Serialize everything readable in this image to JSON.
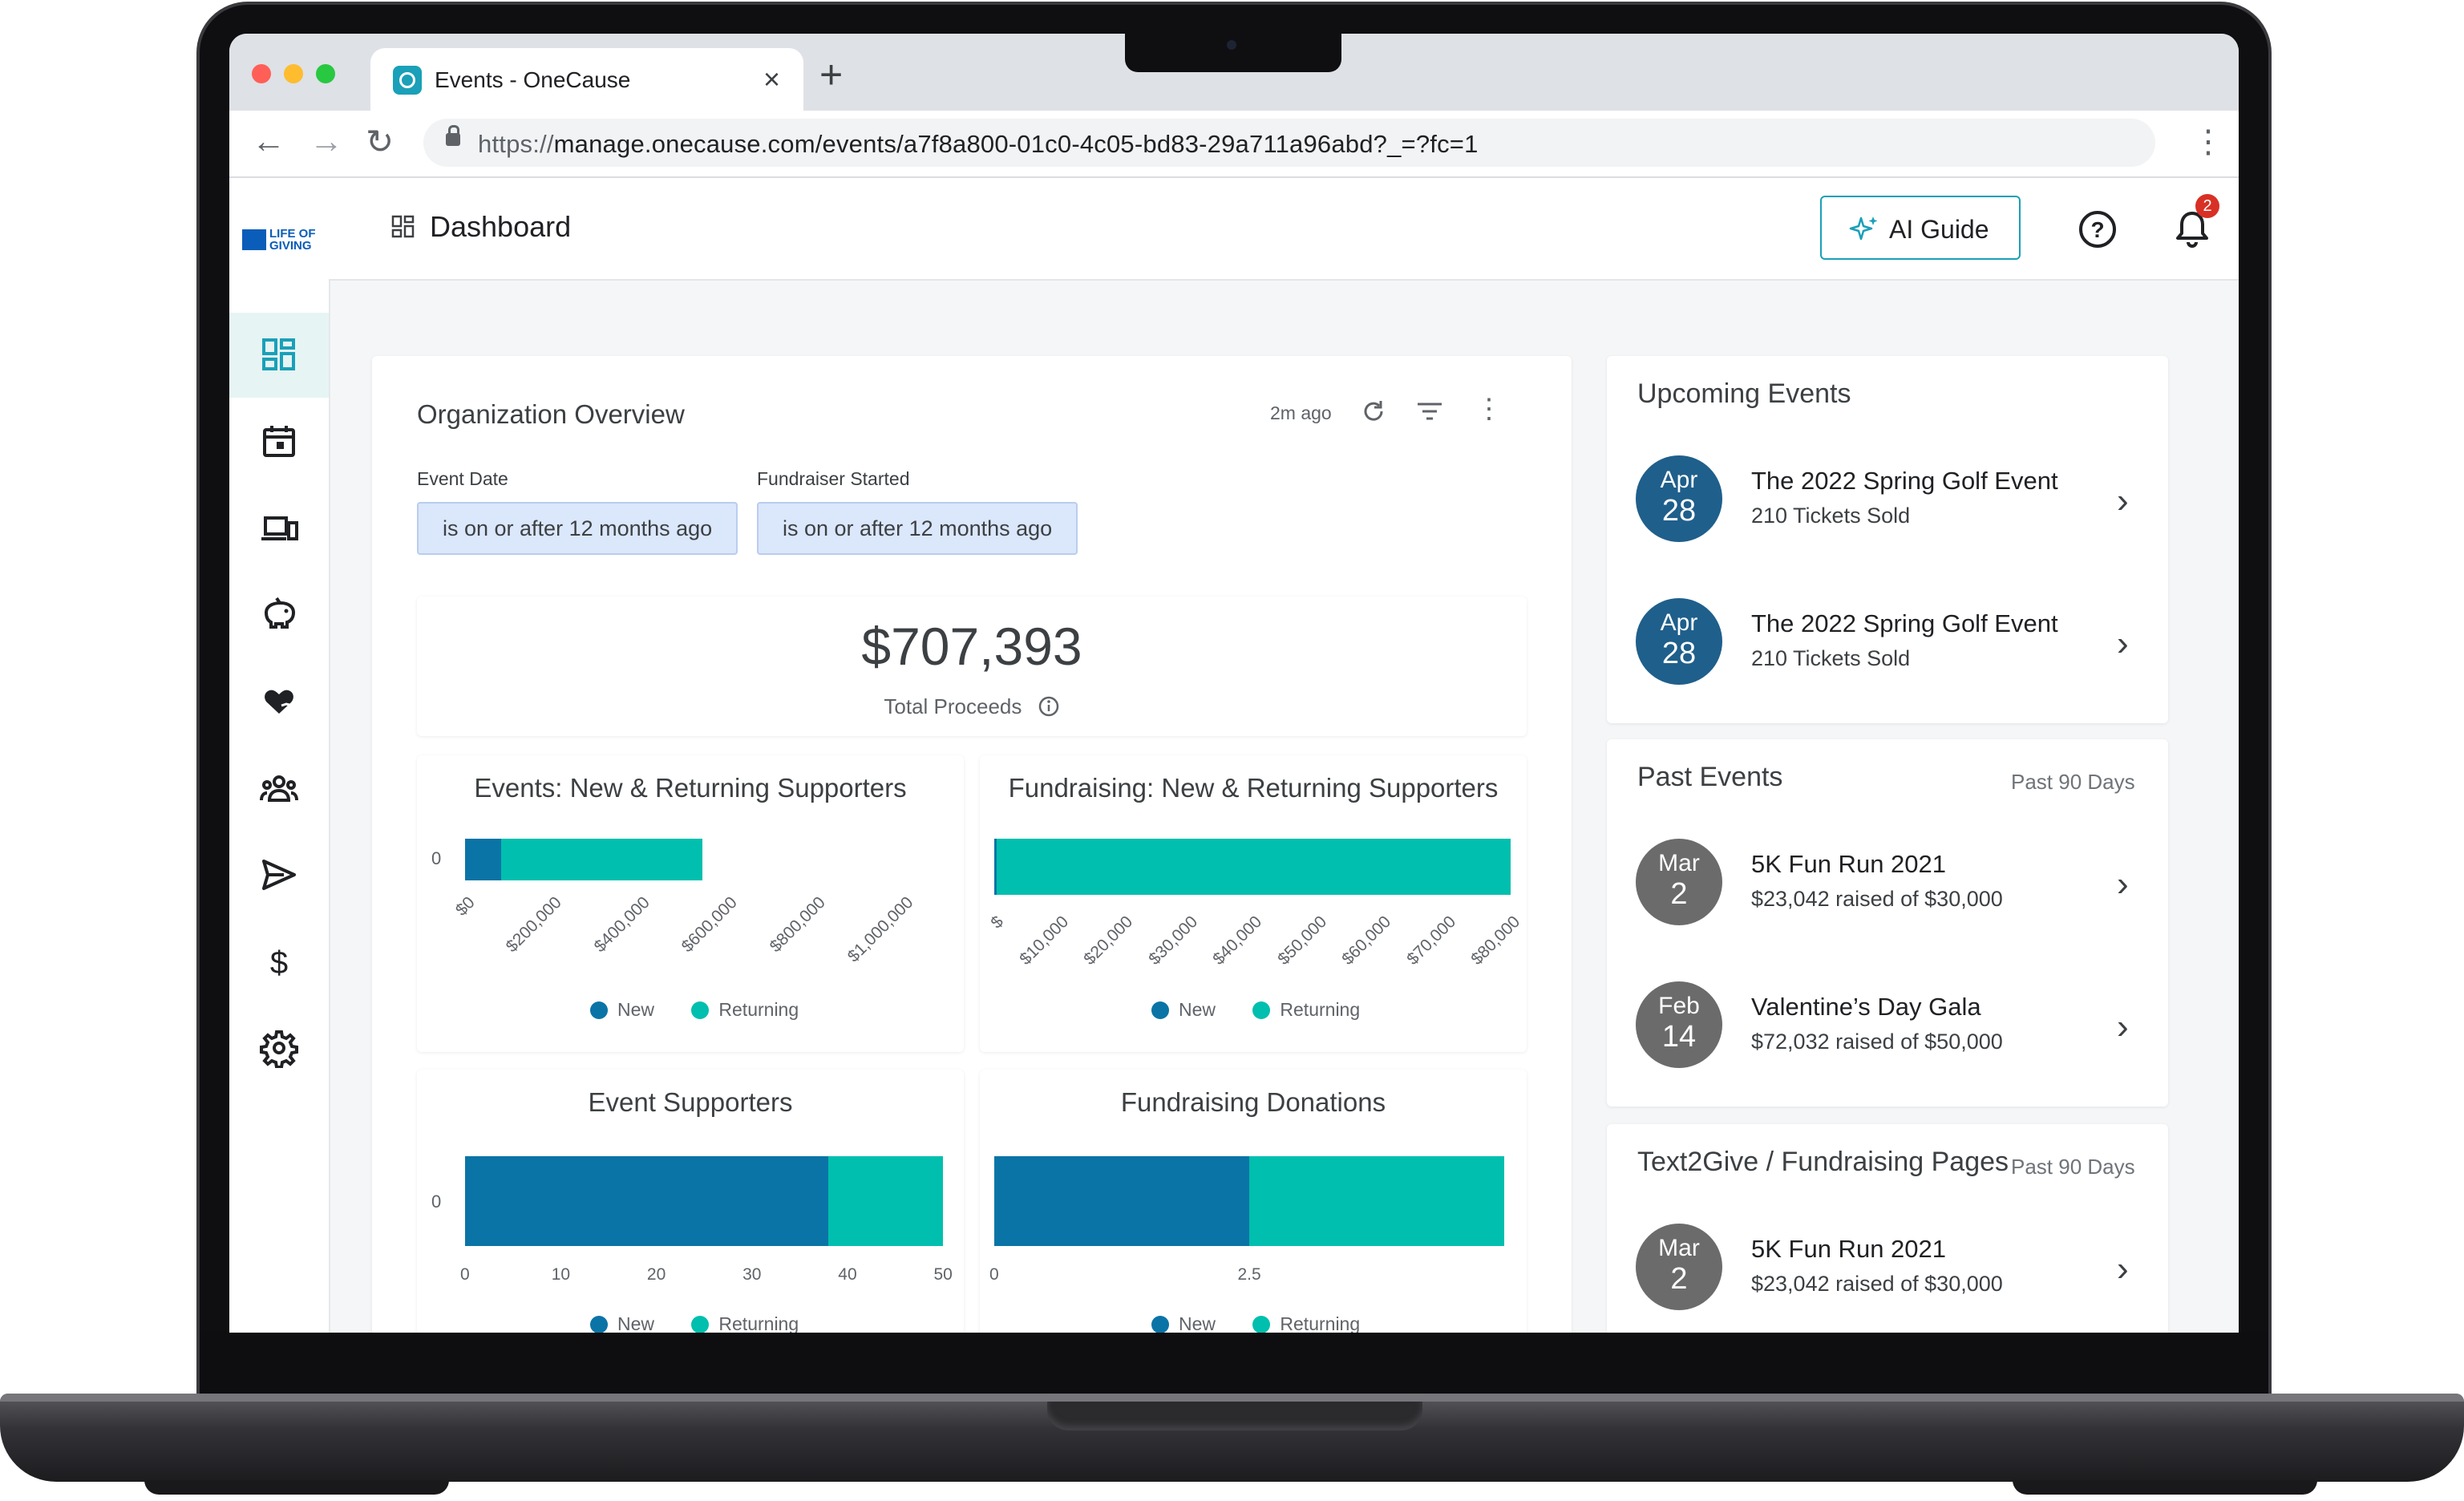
{
  "browser": {
    "tab_title": "Events - OneCause",
    "tab_close": "×",
    "new_tab": "+",
    "url_prefix": "https://",
    "url_rest": "manage.onecause.com/events/a7f8a800-01c0-4c05-bd83-29a711a96abd?_=?fc=1"
  },
  "logo": {
    "line1": "LIFE OF",
    "line2": "GIVING"
  },
  "header": {
    "title": "Dashboard",
    "ai_guide": "AI Guide",
    "notification_count": "2"
  },
  "sidebar": {
    "items": [
      "dashboard-icon",
      "calendar-icon",
      "devices-icon",
      "piggy-bank-icon",
      "heart-hand-icon",
      "people-icon",
      "send-icon",
      "dollar-icon",
      "gear-icon"
    ]
  },
  "overview": {
    "title": "Organization Overview",
    "updated": "2m ago",
    "filters": [
      {
        "label": "Event Date",
        "value": "is on or after 12 months ago"
      },
      {
        "label": "Fundraiser Started",
        "value": "is on or after 12 months ago"
      }
    ],
    "total_proceeds": "$707,393",
    "total_proceeds_label": "Total Proceeds"
  },
  "legend": {
    "new": "New",
    "returning": "Returning"
  },
  "colors": {
    "new": "#0a74a6",
    "returning": "#00bfae",
    "accent": "#1aa0b8",
    "date_upcoming": "#1f5f8b",
    "date_past": "#6b6b6b"
  },
  "chart_data": [
    {
      "type": "bar",
      "title": "Events: New & Returning Supporters",
      "orientation": "horizontal-stacked",
      "categories": [
        "0"
      ],
      "series": [
        {
          "name": "New",
          "values": [
            90000
          ]
        },
        {
          "name": "Returning",
          "values": [
            500000
          ]
        }
      ],
      "x_ticks": [
        "$0",
        "$200,000",
        "$400,000",
        "$600,000",
        "$800,000",
        "$1,000,000"
      ],
      "xlim": [
        0,
        1200000
      ]
    },
    {
      "type": "bar",
      "title": "Fundraising: New & Returning Supporters",
      "orientation": "horizontal-stacked",
      "categories": [
        ""
      ],
      "series": [
        {
          "name": "New",
          "values": [
            400
          ]
        },
        {
          "name": "Returning",
          "values": [
            82000
          ]
        }
      ],
      "x_ticks": [
        "$",
        "$10,000",
        "$20,000",
        "$30,000",
        "$40,000",
        "$50,000",
        "$60,000",
        "$70,000",
        "$80,000"
      ],
      "xlim": [
        0,
        82400
      ]
    },
    {
      "type": "bar",
      "title": "Event Supporters",
      "orientation": "horizontal-stacked",
      "categories": [
        "0"
      ],
      "series": [
        {
          "name": "New",
          "values": [
            38
          ]
        },
        {
          "name": "Returning",
          "values": [
            12
          ]
        }
      ],
      "x_ticks": [
        "0",
        "10",
        "20",
        "30",
        "40",
        "50"
      ],
      "xlim": [
        0,
        50
      ]
    },
    {
      "type": "bar",
      "title": "Fundraising Donations",
      "orientation": "horizontal-stacked",
      "categories": [
        ""
      ],
      "series": [
        {
          "name": "New",
          "values": [
            2
          ]
        },
        {
          "name": "Returning",
          "values": [
            2
          ]
        }
      ],
      "x_ticks": [
        "0",
        "2.5"
      ],
      "xlim": [
        0,
        4
      ]
    }
  ],
  "upcoming": {
    "title": "Upcoming Events",
    "events": [
      {
        "month": "Apr",
        "day": "28",
        "name": "The 2022 Spring Golf Event",
        "meta": "210 Tickets Sold"
      },
      {
        "month": "Apr",
        "day": "28",
        "name": "The 2022 Spring Golf Event",
        "meta": "210 Tickets Sold"
      }
    ]
  },
  "past": {
    "title": "Past Events",
    "range": "Past 90 Days",
    "events": [
      {
        "month": "Mar",
        "day": "2",
        "name": "5K Fun Run 2021",
        "meta": "$23,042 raised of $30,000"
      },
      {
        "month": "Feb",
        "day": "14",
        "name": "Valentine’s Day Gala",
        "meta": "$72,032 raised of $50,000"
      }
    ]
  },
  "text2give": {
    "title": "Text2Give / Fundraising Pages",
    "range": "Past 90 Days",
    "events": [
      {
        "month": "Mar",
        "day": "2",
        "name": "5K Fun Run 2021",
        "meta": "$23,042 raised of $30,000"
      }
    ]
  }
}
